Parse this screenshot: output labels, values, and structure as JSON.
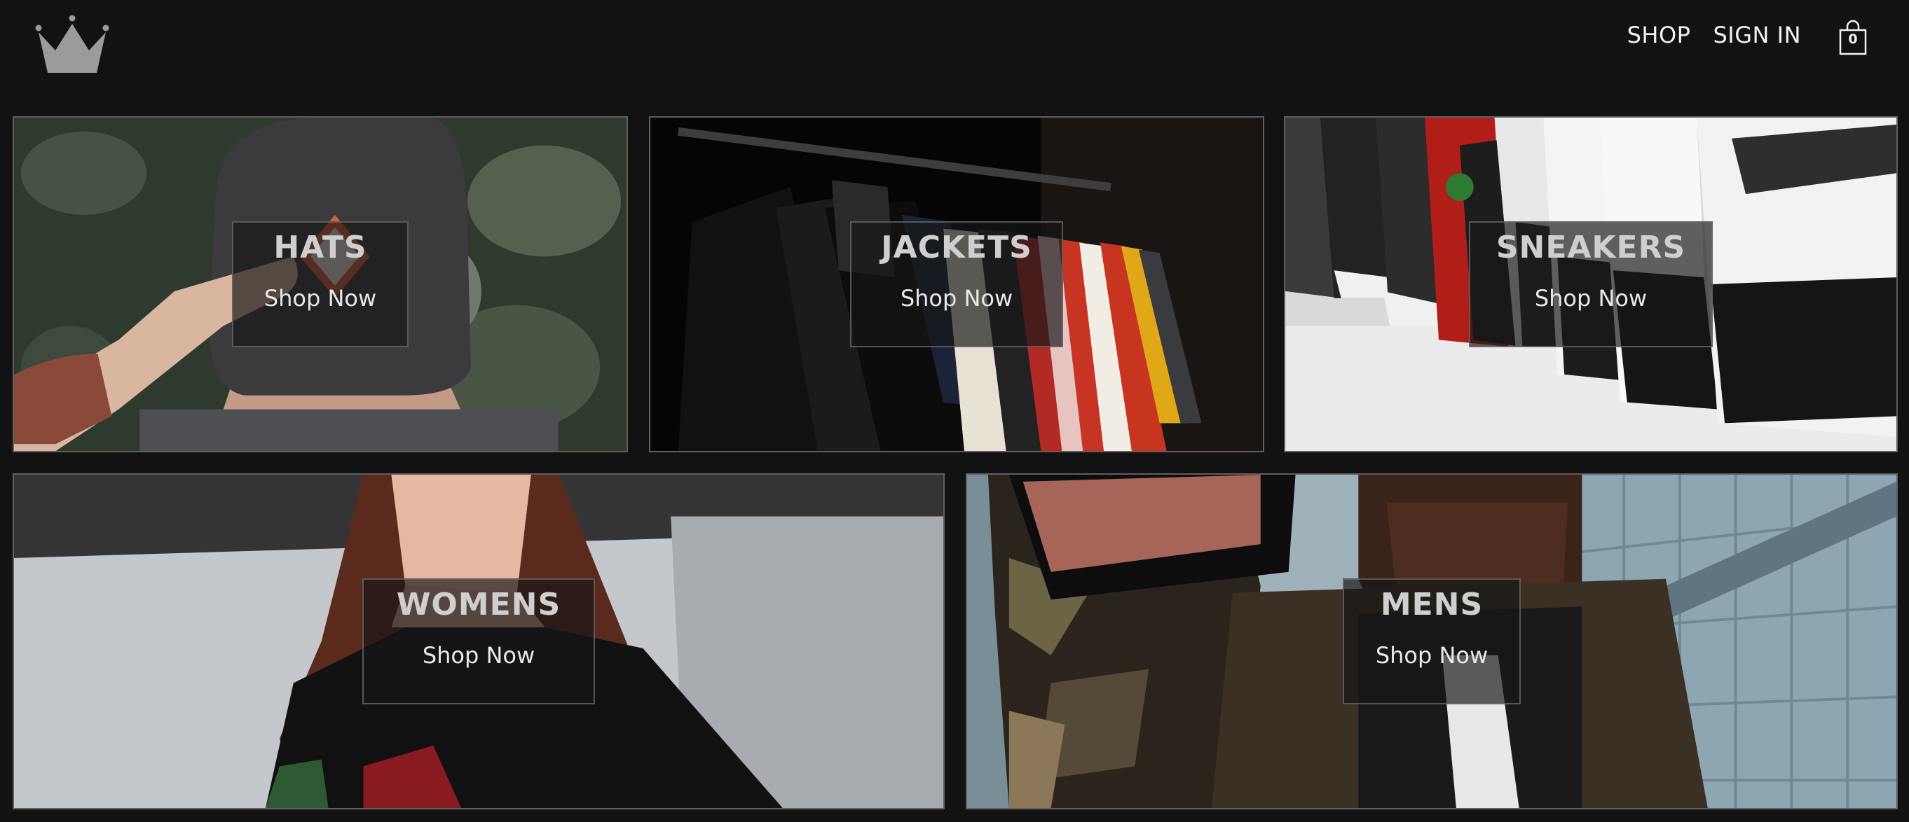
{
  "nav": {
    "shop_label": "SHOP",
    "signin_label": "SIGN IN",
    "cart_count": "0"
  },
  "icons": {
    "logo": "crown-icon",
    "cart": "shopping-bag-icon"
  },
  "categories": [
    {
      "title": "HATS",
      "cta": "Shop Now"
    },
    {
      "title": "JACKETS",
      "cta": "Shop Now"
    },
    {
      "title": "SNEAKERS",
      "cta": "Shop Now"
    },
    {
      "title": "WOMENS",
      "cta": "Shop Now"
    },
    {
      "title": "MENS",
      "cta": "Shop Now"
    }
  ],
  "colors": {
    "background": "#121212",
    "text": "#f2f2f2",
    "tile_border": "#5f5f5f"
  }
}
